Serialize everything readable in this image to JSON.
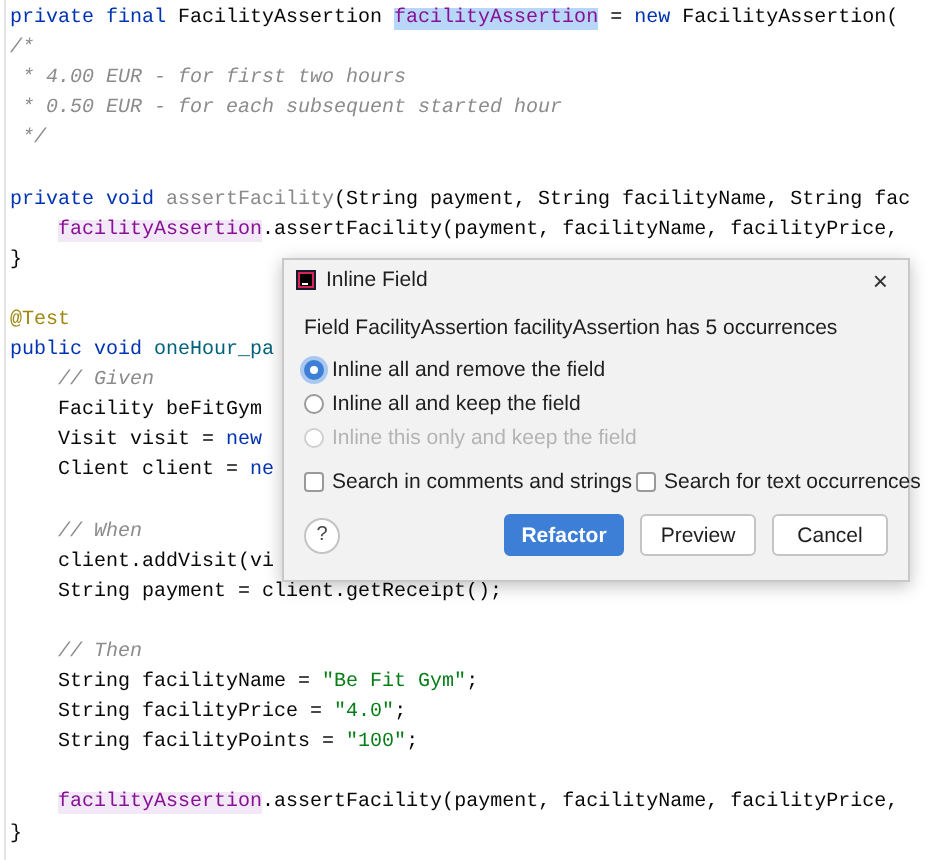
{
  "code_blocks": [
    [
      [
        {
          "kind": "keyword",
          "text": "private final "
        },
        {
          "kind": "plain",
          "text": "FacilityAssertion "
        },
        {
          "kind": "field_selected",
          "text": "facilityAssertion"
        },
        {
          "kind": "plain",
          "text": " = "
        },
        {
          "kind": "keyword",
          "text": "new "
        },
        {
          "kind": "plain",
          "text": "FacilityAssertion("
        }
      ],
      [
        {
          "kind": "comment",
          "text": "/*"
        }
      ],
      [
        {
          "kind": "comment",
          "text": " * 4.00 EUR - for first two hours"
        }
      ],
      [
        {
          "kind": "comment",
          "text": " * 0.50 EUR - for each subsequent started hour"
        }
      ],
      [
        {
          "kind": "comment",
          "text": " */"
        }
      ]
    ],
    [
      [
        {
          "kind": "keyword",
          "text": "private void "
        },
        {
          "kind": "unused",
          "text": "assertFacility"
        },
        {
          "kind": "plain",
          "text": "(String payment, String facilityName, String fac"
        }
      ],
      [
        {
          "kind": "field",
          "text": "    facilityAssertion"
        },
        {
          "kind": "plain",
          "text": ".assertFacility(payment, facilityName, facilityPrice,"
        }
      ],
      [
        {
          "kind": "plain",
          "text": "}"
        }
      ]
    ],
    [
      [
        {
          "kind": "annotation",
          "text": "@Test"
        }
      ],
      [
        {
          "kind": "keyword",
          "text": "public void "
        },
        {
          "kind": "method",
          "text": "oneHour_pa"
        }
      ],
      [
        {
          "kind": "comment",
          "text": "    // Given"
        }
      ],
      [
        {
          "kind": "plain",
          "text": "    Facility beFitGym"
        }
      ],
      [
        {
          "kind": "plain",
          "text": "    Visit visit = "
        },
        {
          "kind": "keyword",
          "text": "new"
        }
      ],
      [
        {
          "kind": "plain",
          "text": "    Client client = "
        },
        {
          "kind": "keyword",
          "text": "ne"
        }
      ]
    ],
    [
      [
        {
          "kind": "comment",
          "text": "    // When"
        }
      ],
      [
        {
          "kind": "plain",
          "text": "    client.addVisit(vi"
        }
      ],
      [
        {
          "kind": "plain",
          "text": "    String payment = client.getReceipt();"
        }
      ]
    ],
    [
      [
        {
          "kind": "comment",
          "text": "    // Then"
        }
      ],
      [
        {
          "kind": "plain",
          "text": "    String facilityName = "
        },
        {
          "kind": "string",
          "text": "\"Be Fit Gym\""
        },
        {
          "kind": "plain",
          "text": ";"
        }
      ],
      [
        {
          "kind": "plain",
          "text": "    String facilityPrice = "
        },
        {
          "kind": "string",
          "text": "\"4.0\""
        },
        {
          "kind": "plain",
          "text": ";"
        }
      ],
      [
        {
          "kind": "plain",
          "text": "    String facilityPoints = "
        },
        {
          "kind": "string",
          "text": "\"100\""
        },
        {
          "kind": "plain",
          "text": ";"
        }
      ]
    ],
    [
      [
        {
          "kind": "field",
          "text": "    facilityAssertion"
        },
        {
          "kind": "plain",
          "text": ".assertFacility(payment, facilityName, facilityPrice,"
        }
      ],
      [
        {
          "kind": "plain",
          "text": "}"
        }
      ]
    ]
  ],
  "dialog": {
    "title": "Inline Field",
    "close": "×",
    "message": "Field FacilityAssertion facilityAssertion has 5 occurrences",
    "options": [
      {
        "label": "Inline all and remove the field",
        "selected": true,
        "disabled": false
      },
      {
        "label": "Inline all and keep the field",
        "selected": false,
        "disabled": false
      },
      {
        "label": "Inline this only and keep the field",
        "selected": false,
        "disabled": true
      }
    ],
    "checkboxes": [
      {
        "label": "Search in comments and strings",
        "checked": false
      },
      {
        "label": "Search for text occurrences",
        "checked": false
      }
    ],
    "help": "?",
    "buttons": [
      {
        "label": "Refactor",
        "kind": "primary"
      },
      {
        "label": "Preview",
        "kind": "secondary"
      },
      {
        "label": "Cancel",
        "kind": "secondary"
      }
    ]
  }
}
